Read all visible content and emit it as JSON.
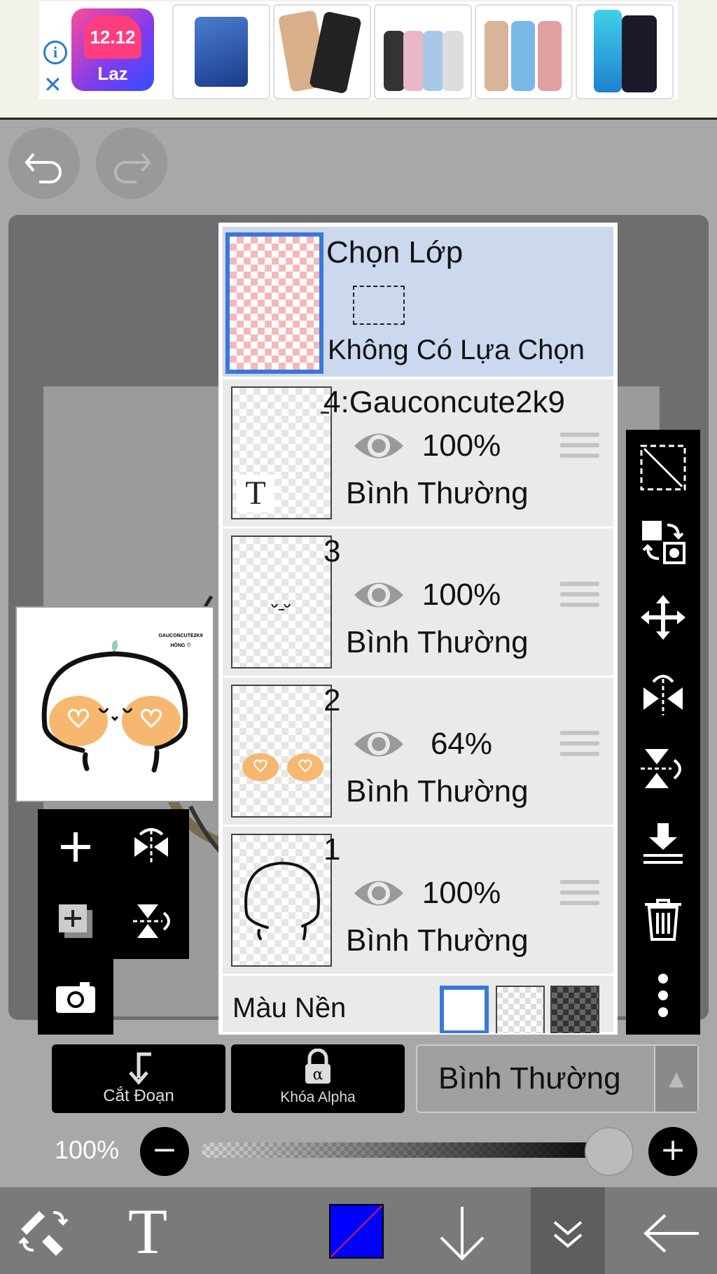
{
  "ad": {
    "brand_badge": "12.12",
    "brand_name": "Laz",
    "info_icon": "info-icon",
    "close_icon": "close-icon"
  },
  "history": {
    "undo_icon": "undo-icon",
    "redo_icon": "redo-icon"
  },
  "layer_panel": {
    "selection": {
      "title": "Chọn Lớp",
      "status": "Không Có Lựa Chọn"
    },
    "layers": [
      {
        "name": "4:Gauconcute2k9",
        "opacity": "100%",
        "blend": "Bình Thường"
      },
      {
        "name": "3",
        "opacity": "100%",
        "blend": "Bình Thường"
      },
      {
        "name": "2",
        "opacity": "64%",
        "blend": "Bình Thường"
      },
      {
        "name": "1",
        "opacity": "100%",
        "blend": "Bình Thường"
      }
    ],
    "background": {
      "label": "Màu Nền"
    }
  },
  "preview_text": {
    "line1": "GAUCONCUTE2K9",
    "line2": "HỒNG ♡"
  },
  "controls": {
    "clipping_label": "Cắt Đoạn",
    "alpha_lock_label": "Khóa Alpha",
    "blend_mode": "Bình Thường",
    "opacity": "100%",
    "opacity_value": 1.0
  },
  "colors": {
    "current_color": "#0000ff",
    "selection_highlight": "#ccd8ee",
    "accent": "#3a78d8"
  }
}
